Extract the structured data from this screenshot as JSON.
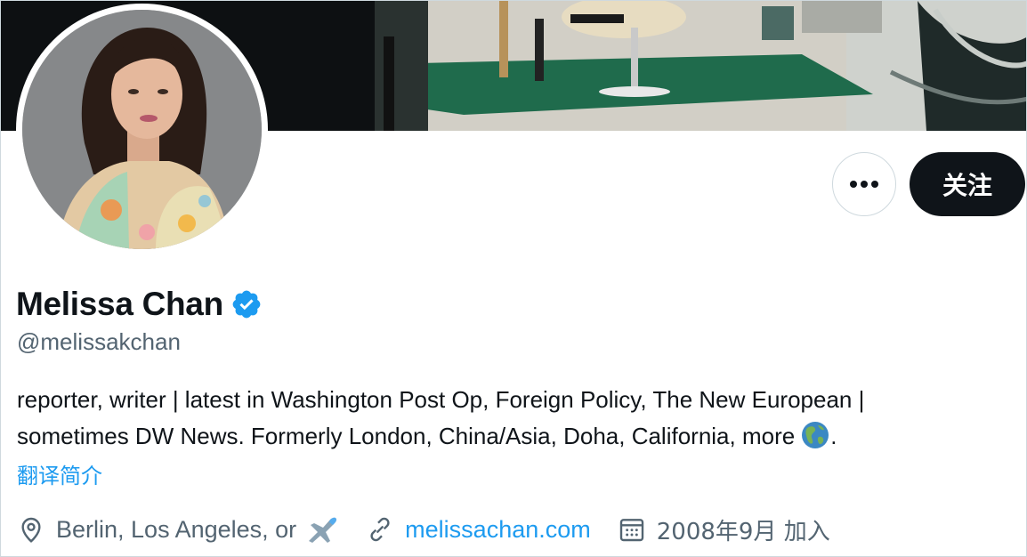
{
  "profile": {
    "name": "Melissa Chan",
    "handle": "@melissakchan",
    "verified_icon": "verified-badge-icon",
    "bio_line1": "reporter, writer | latest in Washington Post Op, Foreign Policy, The New European |",
    "bio_line2": "sometimes DW News. Formerly London, China/Asia, Doha, California, more",
    "bio_end": ".",
    "bio_emoji": "globe-americas-icon",
    "translate_label": "翻译简介"
  },
  "actions": {
    "more_icon": "more-horizontal-icon",
    "follow_label": "关注"
  },
  "meta": {
    "location": "Berlin, Los Angeles, or",
    "location_emoji": "airplane-icon",
    "website": "melissachan.com",
    "joined": "2008年9月 加入"
  },
  "colors": {
    "accent": "#1d9bf0",
    "text": "#0f1419",
    "secondary": "#536471",
    "follow_bg": "#0f1419"
  }
}
